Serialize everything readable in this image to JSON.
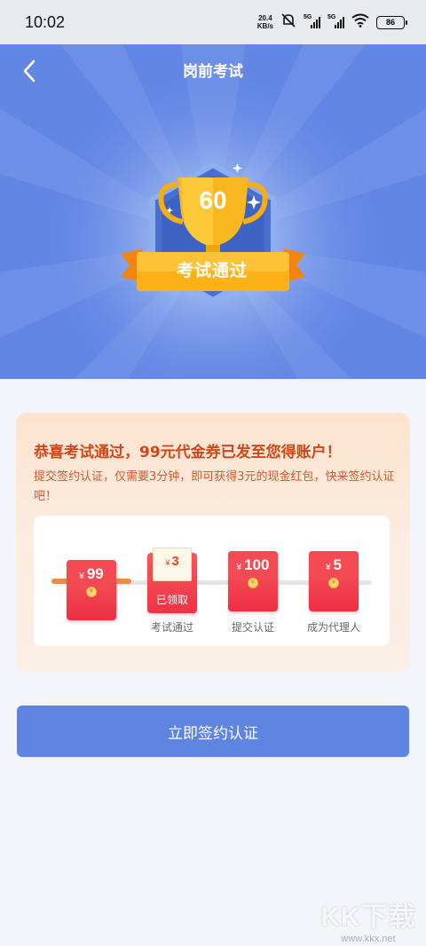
{
  "status_bar": {
    "time": "10:02",
    "speed_value": "20.4",
    "speed_unit": "KB/s",
    "network_1": "5G",
    "network_2": "5G",
    "battery": "86"
  },
  "header": {
    "title": "岗前考试",
    "back_icon": "chevron-left-icon"
  },
  "result": {
    "score": "60",
    "badge_label": "考试通过"
  },
  "reward_card": {
    "title": "恭喜考试通过，99元代金券已发至您得账户！",
    "description": "提交签约认证，仅需要3分钟，即可获得3元的现金红包，快来签约认证吧！",
    "currency_symbol": "¥",
    "steps": [
      {
        "amount": "99",
        "label": ""
      },
      {
        "amount": "3",
        "status": "已领取",
        "label": "考试通过"
      },
      {
        "amount": "100",
        "label": "提交认证"
      },
      {
        "amount": "5",
        "label": "成为代理人"
      }
    ]
  },
  "cta": {
    "label": "立即签约认证"
  },
  "watermark": {
    "logo": "KK下载",
    "url": "www.kkx.net"
  },
  "colors": {
    "header_bg": "#6186e4",
    "accent_orange": "#f08a42",
    "title_red": "#d1471a",
    "button_blue": "#5f85e3"
  }
}
